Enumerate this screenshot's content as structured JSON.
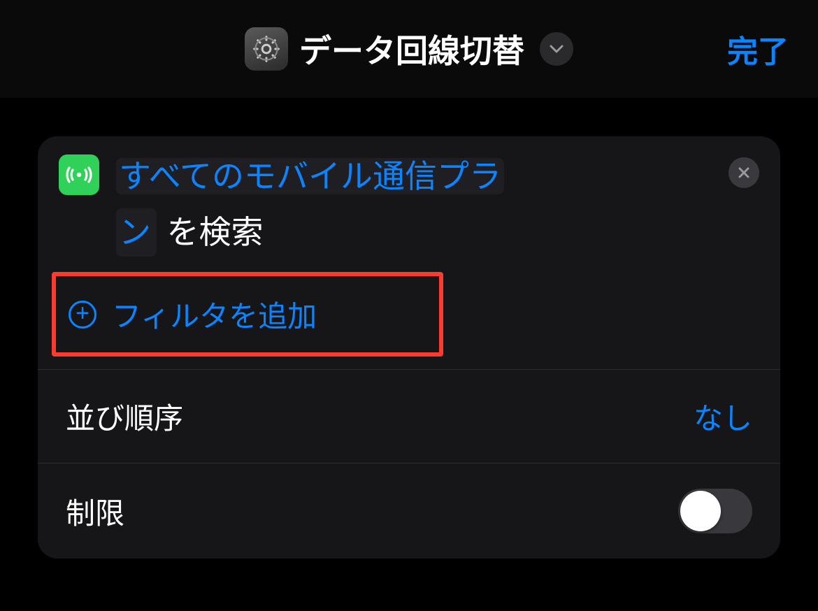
{
  "header": {
    "title": "データ回線切替",
    "done": "完了"
  },
  "search": {
    "token_line1": "すべてのモバイル通信プラ",
    "token_line2": "ン",
    "suffix": "を検索"
  },
  "filter": {
    "add_label": "フィルタを追加"
  },
  "sort": {
    "label": "並び順序",
    "value": "なし"
  },
  "limit": {
    "label": "制限",
    "on": false
  },
  "colors": {
    "accent": "#0a84ff",
    "green": "#30d158",
    "highlight": "#ff3b30"
  }
}
